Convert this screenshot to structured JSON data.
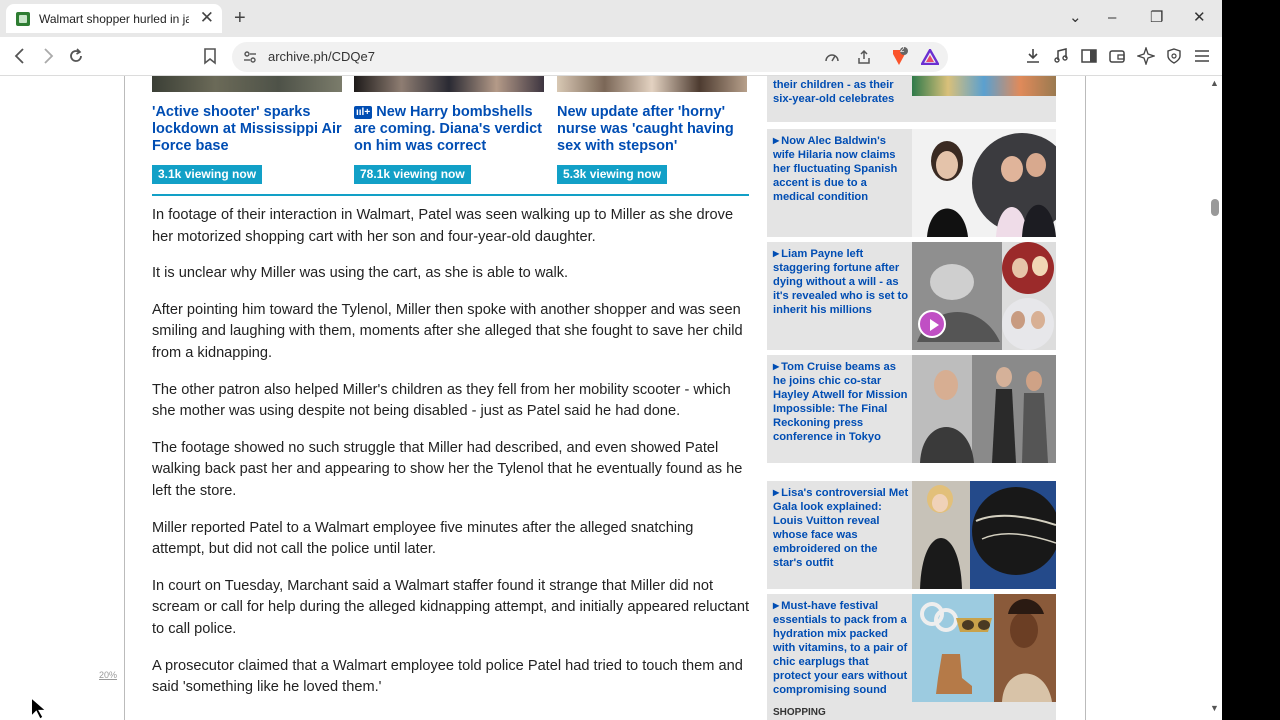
{
  "browser": {
    "tab_title": "Walmart shopper hurled in jail a",
    "url": "archive.ph/CDQe7",
    "shield_count": "2",
    "window_controls": {
      "minimize": "–",
      "restore": "❐",
      "close": "✕",
      "dropdown": "⌄"
    }
  },
  "icons": {
    "back": "back-arrow-icon",
    "forward": "forward-arrow-icon",
    "reload": "reload-icon",
    "bookmark": "bookmark-icon",
    "site_settings": "site-settings-icon",
    "download": "download-icon",
    "music": "media-icon",
    "sidebar": "sidebar-icon",
    "wallet": "wallet-icon",
    "leo": "leo-ai-icon",
    "vpn": "vpn-icon",
    "menu": "hamburger-menu-icon"
  },
  "related": [
    {
      "title": "'Active shooter' sparks lockdown at Mississippi Air Force base",
      "viewing": "3.1k viewing now"
    },
    {
      "badge": "+",
      "title": "New Harry bombshells are coming. Diana's verdict on him was correct",
      "viewing": "78.1k viewing now"
    },
    {
      "title": "New update after 'horny' nurse was 'caught having sex with stepson'",
      "viewing": "5.3k viewing now"
    }
  ],
  "article": {
    "paragraphs": [
      "In footage of their interaction in Walmart, Patel was seen walking up to Miller as she drove her motorized shopping cart with her son and four-year-old daughter.",
      "It is unclear why Miller was using the cart, as she is able to walk.",
      "After pointing him toward the Tylenol, Miller then spoke with another shopper and was seen smiling and laughing with them, moments after she alleged that she fought to save her child from a kidnapping.",
      "The other patron also helped Miller's children as they fell from her mobility scooter - which she mother was using despite not being disabled - just as Patel said he had done.",
      "The footage showed no such struggle that Miller had described, and even showed Patel walking back past her and appearing to show her the Tylenol that he eventually found as he left the store.",
      "Miller reported Patel to a Walmart employee five minutes after the alleged snatching attempt, but did not call the police until later.",
      "In court on Tuesday, Marchant said a Walmart staffer found it strange that Miller did not scream or call for help during the alleged kidnapping attempt, and initially appeared reluctant to call police.",
      "A prosecutor claimed that a Walmart employee told police Patel had tried to touch them and said 'something like he loved them.'"
    ]
  },
  "sidebar": [
    {
      "title": "their children - as their six-year-old celebrates"
    },
    {
      "title": "Now Alec Baldwin's wife Hilaria now claims her fluctuating Spanish accent is due to a medical condition"
    },
    {
      "title": "Liam Payne left staggering fortune after dying without a will - as it's revealed who is set to inherit his millions"
    },
    {
      "title": "Tom Cruise beams as he joins chic co-star Hayley Atwell for Mission Impossible: The Final Reckoning press conference in Tokyo"
    },
    {
      "title": "Lisa's controversial Met Gala look explained: Louis Vuitton reveal whose face was embroidered on the star's outfit"
    },
    {
      "title": "Must-have festival essentials to pack from a hydration mix packed with vitamins, to a pair of chic earplugs that protect your ears without compromising sound",
      "sub": "SHOPPING"
    }
  ],
  "zoom_note": "20%",
  "colors": {
    "link_blue": "#004db3",
    "accent_cyan": "#12a0c7",
    "sidebar_bg": "#e4e4e4",
    "play_pink": "#c04fc4"
  }
}
